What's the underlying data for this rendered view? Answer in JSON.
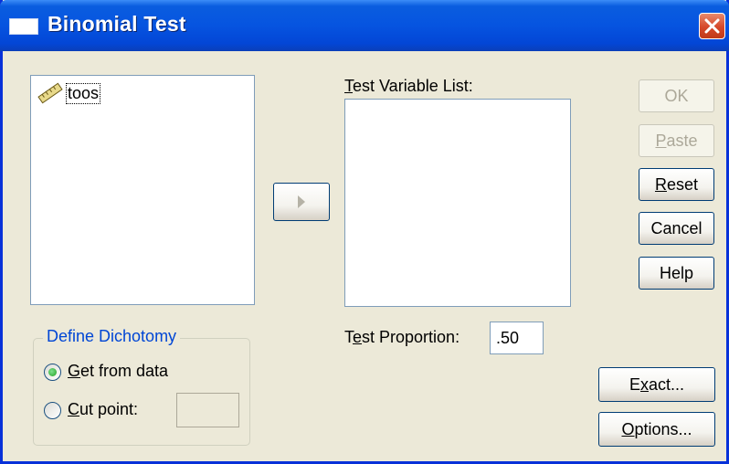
{
  "window": {
    "title": "Binomial Test"
  },
  "icons": {
    "title_icon": "window-icon",
    "close_icon": "close-icon",
    "variable_icon": "ruler-scale-icon",
    "arrow_icon": "right-arrow-icon"
  },
  "source_list": {
    "items": [
      {
        "label": "toos",
        "icon": "ruler-scale-icon"
      }
    ]
  },
  "test_variable_list": {
    "label_pre": "",
    "label_u": "T",
    "label_post": "est Variable List:",
    "items": []
  },
  "buttons": {
    "ok": {
      "pre": "",
      "u": "",
      "post": "OK",
      "enabled": false
    },
    "paste": {
      "pre": "",
      "u": "P",
      "post": "aste",
      "enabled": false
    },
    "reset": {
      "pre": "",
      "u": "R",
      "post": "eset",
      "enabled": true
    },
    "cancel": {
      "pre": "",
      "u": "",
      "post": "Cancel",
      "enabled": true
    },
    "help": {
      "pre": "",
      "u": "",
      "post": "Help",
      "enabled": true
    },
    "exact": {
      "pre": "E",
      "u": "x",
      "post": "act...",
      "enabled": true
    },
    "options": {
      "pre": "",
      "u": "O",
      "post": "ptions...",
      "enabled": true
    }
  },
  "define_dichotomy": {
    "title": "Define Dichotomy",
    "get_from_data": {
      "pre": "",
      "u": "G",
      "post": "et from data",
      "selected": true
    },
    "cut_point": {
      "pre": "",
      "u": "C",
      "post": "ut point:",
      "selected": false,
      "value": ""
    }
  },
  "test_proportion": {
    "label_pre": "T",
    "label_u": "e",
    "label_post": "st Proportion:",
    "value": ".50"
  }
}
